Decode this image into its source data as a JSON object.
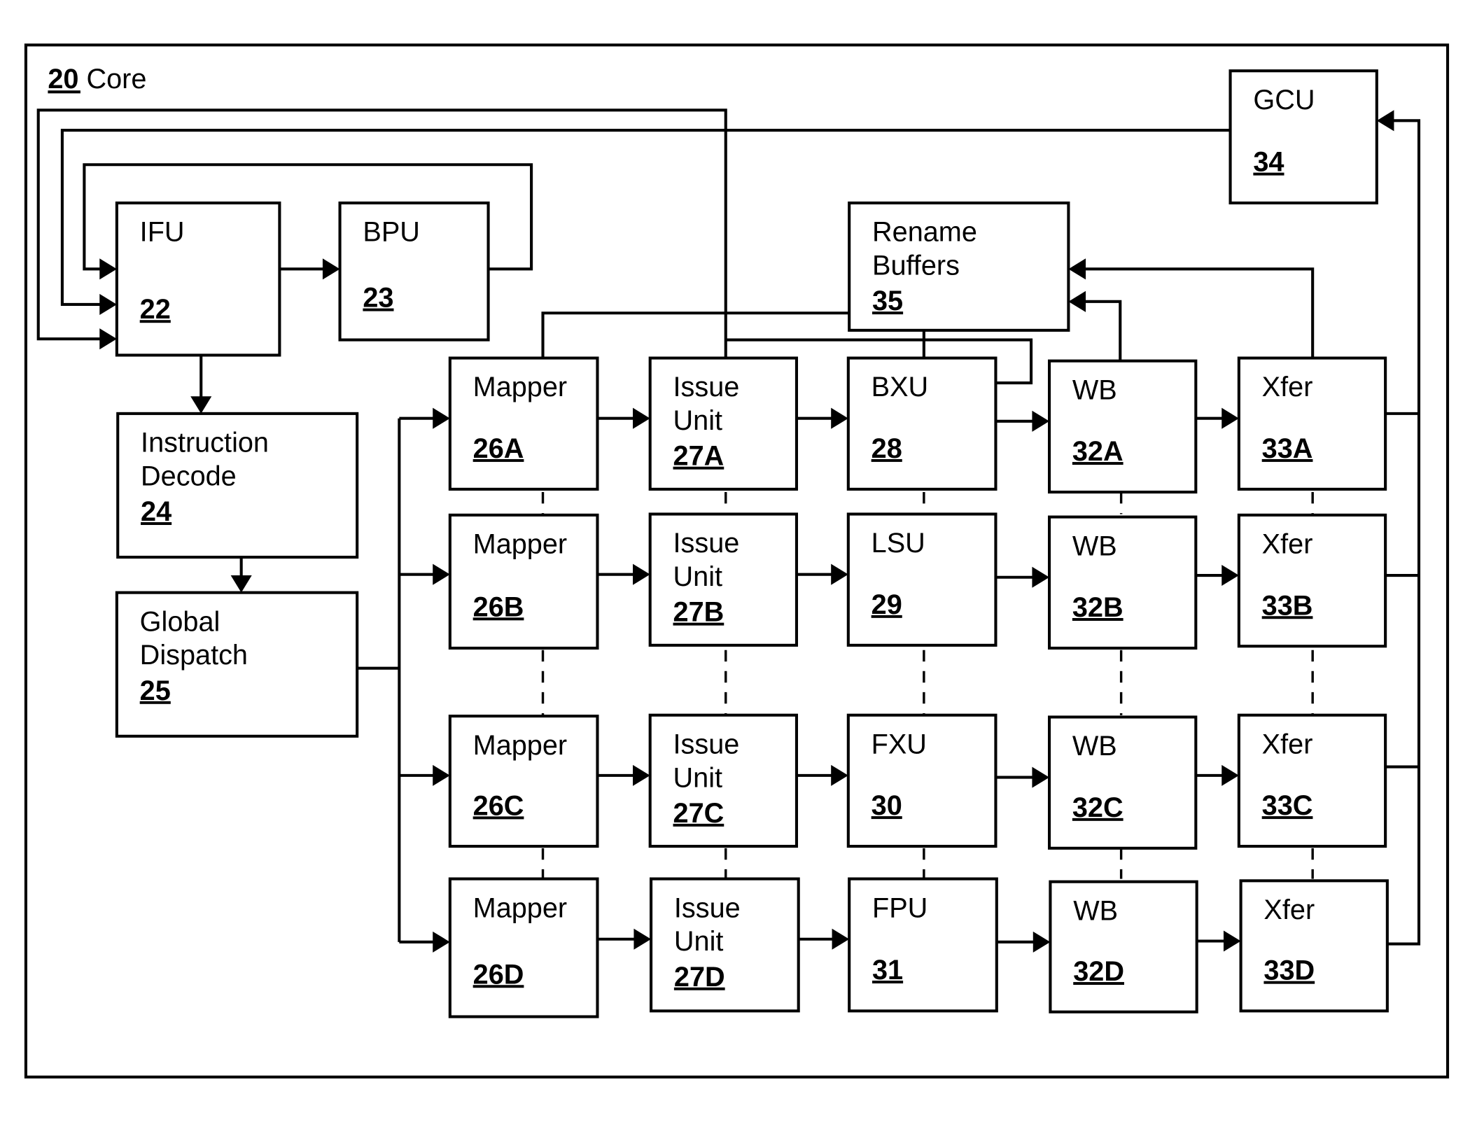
{
  "title": {
    "ref": "20",
    "text": "Core"
  },
  "blocks": [
    {
      "id": "ifu",
      "lines": [
        "IFU"
      ],
      "ref": "22"
    },
    {
      "id": "bpu",
      "lines": [
        "BPU"
      ],
      "ref": "23"
    },
    {
      "id": "decode",
      "lines": [
        "Instruction",
        " Decode"
      ],
      "ref": "24"
    },
    {
      "id": "dispatch",
      "lines": [
        "Global",
        "Dispatch"
      ],
      "ref": "25"
    },
    {
      "id": "gcu",
      "lines": [
        "GCU"
      ],
      "ref": "34"
    },
    {
      "id": "rename",
      "lines": [
        "Rename",
        "Buffers"
      ],
      "ref": "35"
    },
    {
      "id": "mapA",
      "lines": [
        "Mapper"
      ],
      "ref": "26A"
    },
    {
      "id": "mapB",
      "lines": [
        "Mapper"
      ],
      "ref": "26B"
    },
    {
      "id": "mapC",
      "lines": [
        "Mapper"
      ],
      "ref": "26C"
    },
    {
      "id": "mapD",
      "lines": [
        "Mapper"
      ],
      "ref": "26D"
    },
    {
      "id": "issA",
      "lines": [
        "Issue",
        "Unit"
      ],
      "ref": "27A"
    },
    {
      "id": "issB",
      "lines": [
        "Issue",
        "Unit"
      ],
      "ref": "27B"
    },
    {
      "id": "issC",
      "lines": [
        "Issue",
        "Unit"
      ],
      "ref": "27C"
    },
    {
      "id": "issD",
      "lines": [
        "Issue",
        "Unit"
      ],
      "ref": "27D"
    },
    {
      "id": "bxu",
      "lines": [
        "BXU"
      ],
      "ref": "28"
    },
    {
      "id": "lsu",
      "lines": [
        "LSU"
      ],
      "ref": "29"
    },
    {
      "id": "fxu",
      "lines": [
        "FXU"
      ],
      "ref": "30"
    },
    {
      "id": "fpu",
      "lines": [
        "FPU"
      ],
      "ref": "31"
    },
    {
      "id": "wbA",
      "lines": [
        "WB"
      ],
      "ref": "32A"
    },
    {
      "id": "wbB",
      "lines": [
        "WB"
      ],
      "ref": "32B"
    },
    {
      "id": "wbC",
      "lines": [
        "WB"
      ],
      "ref": "32C"
    },
    {
      "id": "wbD",
      "lines": [
        "WB"
      ],
      "ref": "32D"
    },
    {
      "id": "xfA",
      "lines": [
        "Xfer"
      ],
      "ref": "33A"
    },
    {
      "id": "xfB",
      "lines": [
        "Xfer"
      ],
      "ref": "33B"
    },
    {
      "id": "xfC",
      "lines": [
        "Xfer"
      ],
      "ref": "33C"
    },
    {
      "id": "xfD",
      "lines": [
        "Xfer"
      ],
      "ref": "33D"
    }
  ],
  "connections": [
    {
      "from": "ifu",
      "to": "bpu",
      "kind": "arrow"
    },
    {
      "from": "bpu",
      "to": "ifu",
      "kind": "arrow"
    },
    {
      "from": "ifu",
      "to": "decode",
      "kind": "arrow"
    },
    {
      "from": "decode",
      "to": "dispatch",
      "kind": "arrow"
    },
    {
      "from": "dispatch",
      "to": "mapA",
      "kind": "arrow"
    },
    {
      "from": "dispatch",
      "to": "mapB",
      "kind": "arrow"
    },
    {
      "from": "dispatch",
      "to": "mapC",
      "kind": "arrow"
    },
    {
      "from": "dispatch",
      "to": "mapD",
      "kind": "arrow"
    },
    {
      "from": "mapA",
      "to": "issA",
      "kind": "arrow"
    },
    {
      "from": "mapB",
      "to": "issB",
      "kind": "arrow"
    },
    {
      "from": "mapC",
      "to": "issC",
      "kind": "arrow"
    },
    {
      "from": "mapD",
      "to": "issD",
      "kind": "arrow"
    },
    {
      "from": "issA",
      "to": "bxu",
      "kind": "arrow"
    },
    {
      "from": "issB",
      "to": "lsu",
      "kind": "arrow"
    },
    {
      "from": "issC",
      "to": "fxu",
      "kind": "arrow"
    },
    {
      "from": "issD",
      "to": "fpu",
      "kind": "arrow"
    },
    {
      "from": "bxu",
      "to": "wbA",
      "kind": "arrow"
    },
    {
      "from": "lsu",
      "to": "wbB",
      "kind": "arrow"
    },
    {
      "from": "fxu",
      "to": "wbC",
      "kind": "arrow"
    },
    {
      "from": "fpu",
      "to": "wbD",
      "kind": "arrow"
    },
    {
      "from": "wbA",
      "to": "xfA",
      "kind": "arrow"
    },
    {
      "from": "wbB",
      "to": "xfB",
      "kind": "arrow"
    },
    {
      "from": "wbC",
      "to": "xfC",
      "kind": "arrow"
    },
    {
      "from": "wbD",
      "to": "xfD",
      "kind": "arrow"
    },
    {
      "from": "xfer-bus",
      "to": "gcu",
      "kind": "arrow"
    },
    {
      "from": "wbA",
      "to": "rename",
      "kind": "arrow"
    },
    {
      "from": "xfA",
      "to": "rename",
      "kind": "arrow"
    },
    {
      "from": "gcu",
      "to": "ifu",
      "kind": "arrow"
    },
    {
      "from": "issA",
      "to": "ifu",
      "kind": "arrow"
    },
    {
      "from": "mapA",
      "to": "rename",
      "kind": "line"
    },
    {
      "from": "bxu",
      "to": "rename",
      "kind": "line"
    },
    {
      "from": "bxu",
      "to": "issA-bus",
      "kind": "line"
    }
  ]
}
